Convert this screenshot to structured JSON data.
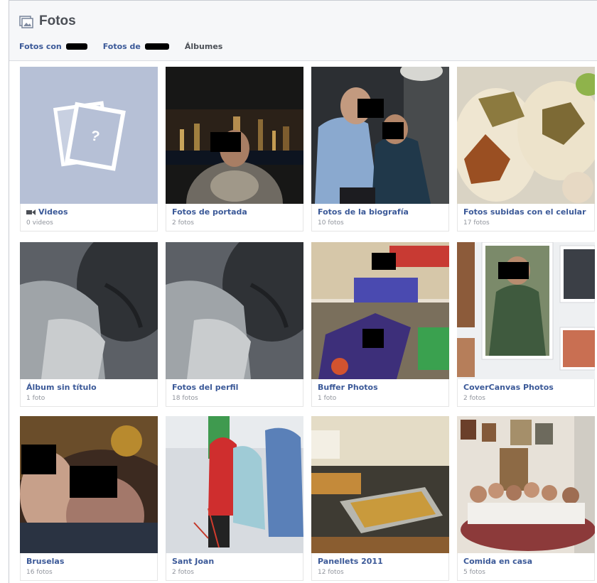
{
  "header": {
    "title": "Fotos",
    "icon": "photos-icon",
    "tabs": [
      {
        "label": "Fotos con",
        "redacted": true
      },
      {
        "label": "Fotos de",
        "redacted": true
      },
      {
        "label": "Álbumes",
        "redacted": false
      }
    ]
  },
  "colors": {
    "link": "#3b5998",
    "count": "#90949c",
    "header_bg": "#f6f7f9",
    "placeholder_bg": "#b6c0d6"
  },
  "albums": [
    {
      "name": "Videos",
      "count": "0 videos",
      "icon": "video-icon"
    },
    {
      "name": "Fotos de portada",
      "count": "2 fotos"
    },
    {
      "name": "Fotos de la biografía",
      "count": "10 fotos"
    },
    {
      "name": "Fotos subidas con el celular",
      "count": "17 fotos"
    },
    {
      "name": "Álbum sin título",
      "count": "1 foto"
    },
    {
      "name": "Fotos del perfil",
      "count": "18 fotos"
    },
    {
      "name": "Buffer Photos",
      "count": "1 foto"
    },
    {
      "name": "CoverCanvas Photos",
      "count": "2 fotos"
    },
    {
      "name": "Bruselas",
      "count": "16 fotos"
    },
    {
      "name": "Sant Joan",
      "count": "2 fotos"
    },
    {
      "name": "Panellets 2011",
      "count": "12 fotos"
    },
    {
      "name": "Comida en casa",
      "count": "5 fotos"
    }
  ]
}
